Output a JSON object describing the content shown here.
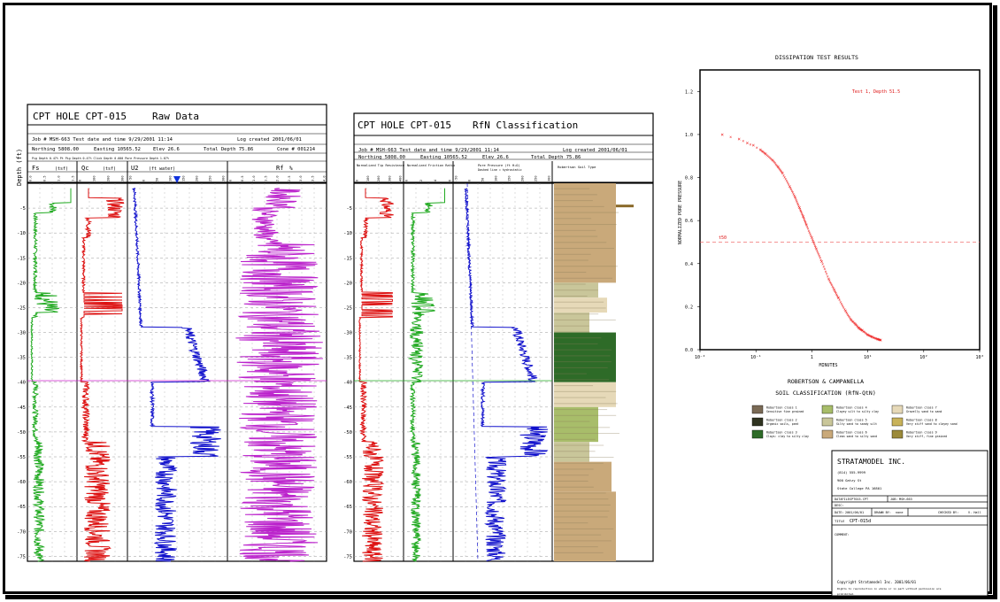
{
  "raw_panel": {
    "title": "CPT HOLE CPT-015",
    "subtitle": "Raw Data",
    "job_line": "Job # MSH-663  Test date and time 9/29/2001 11:14",
    "log_created": "Log created 2001/06/01",
    "northing": "Northing  5808.00",
    "easting": "Easting  10565.52",
    "elev": "Elev  26.6",
    "total_depth": "Total Depth  75.86",
    "cone": "Cone # 001214",
    "smallnote": "Pig Depth 0.47%  Pt Pig Depth 0.47%  Click Depth 0.000  Pore Pressure Depth 1.87%",
    "depth_axis_label": "Depth (ft)",
    "tracks": [
      {
        "label": "Fs",
        "unit": "(tsf)",
        "color": "#22aa22"
      },
      {
        "label": "Qc",
        "unit": "(tsf)",
        "color": "#dd1111"
      },
      {
        "label": "U2",
        "unit": "(ft water)",
        "color": "#1111cc"
      },
      {
        "label": "Rf",
        "unit": "%",
        "color": "#bb22cc"
      }
    ],
    "fs_ticks": [
      "0.0",
      "0.5",
      "1.0",
      "1.5"
    ],
    "qc_ticks": [
      "0",
      "100",
      "200",
      "300"
    ],
    "u2_ticks": [
      "-50",
      "0",
      "50",
      "100",
      "150",
      "200",
      "250",
      "300"
    ],
    "rf_ticks": [
      "0",
      "0.5",
      "1.0",
      "1.5",
      "2.0",
      "2.5",
      "3.0",
      "3.5",
      "4.0"
    ]
  },
  "class_panel": {
    "title": "CPT HOLE CPT-015",
    "subtitle": "RfN Classification",
    "job_line": "Job # MSH-663  Test date and time 9/29/2001 11:14",
    "log_created": "Log created 2001/06/01",
    "northing": "Northing  5808.00",
    "easting": "Easting  10565.52",
    "elev": "Elev  26.6",
    "total_depth": "Total Depth  75.86",
    "col1": "Normalized Tip Resistance",
    "col2": "Normalized Friction Ratio",
    "col3a": "Pore Pressure  (ft H₂O)",
    "col3b": "Dashed line = hydrostatic",
    "col4": "Robertson Soil Type"
  },
  "depth_ticks": [
    "-5",
    "-10",
    "-15",
    "-20",
    "-25",
    "-30",
    "-35",
    "-40",
    "-45",
    "-50",
    "-55",
    "-60",
    "-65",
    "-70",
    "-75"
  ],
  "chart_data": {
    "type": "scatter",
    "title": "DISSIPATION TEST RESULTS",
    "annotation": "Test 1, Depth 51.5",
    "xlabel": "MINUTES",
    "ylabel": "NORMALIZED PORE PRESSURE",
    "xscale": "log",
    "x_ticks": [
      "10⁻²",
      "10⁻¹",
      "1",
      "10¹",
      "10²",
      "10³"
    ],
    "y_ticks": [
      "0.0",
      "0.2",
      "0.4",
      "0.6",
      "0.8",
      "1.0",
      "1.2"
    ],
    "ylim": [
      0,
      1.3
    ],
    "xlim": [
      0.01,
      1000
    ],
    "t50_label": "t50",
    "t50_level": 0.5,
    "series": [
      {
        "x": [
          0.025,
          0.05,
          0.07,
          0.09,
          0.12,
          0.15,
          0.2,
          0.25,
          0.3,
          0.4,
          0.5,
          0.6,
          0.7,
          0.8,
          1.0,
          1.2,
          1.5,
          2.0,
          2.5,
          3.0,
          4.0,
          5.0,
          6.0,
          7.0,
          8.0,
          10.0,
          12.0,
          15.0,
          17.0
        ],
        "y": [
          1.0,
          0.98,
          0.96,
          0.95,
          0.93,
          0.91,
          0.88,
          0.85,
          0.82,
          0.76,
          0.71,
          0.66,
          0.62,
          0.58,
          0.52,
          0.47,
          0.41,
          0.33,
          0.28,
          0.24,
          0.18,
          0.14,
          0.12,
          0.1,
          0.09,
          0.07,
          0.06,
          0.05,
          0.045
        ]
      }
    ]
  },
  "legend": {
    "title1": "ROBERTSON & CAMPANELLA",
    "title2": "SOIL CLASSIFICATION (RfN-QtN)",
    "items": [
      {
        "name": "Robertson class 1",
        "desc": "Sensitive fine grained",
        "color": "#7a6a55"
      },
      {
        "name": "Robertson class 2",
        "desc": "Organic soils, peat",
        "color": "#2f3320"
      },
      {
        "name": "Robertson class 3",
        "desc": "Clays: clay to silty clay",
        "color": "#2e6b28"
      },
      {
        "name": "Robertson class 4",
        "desc": "Clayey silt to silty clay",
        "color": "#a8bd6a"
      },
      {
        "name": "Robertson class 5",
        "desc": "Silty sand to sandy silt",
        "color": "#c9c69a"
      },
      {
        "name": "Robertson class 6",
        "desc": "Clean sand to silty sand",
        "color": "#c9a97a"
      },
      {
        "name": "Robertson class 7",
        "desc": "Gravelly sand to sand",
        "color": "#e6d9b8"
      },
      {
        "name": "Robertson class 8",
        "desc": "Very stiff sand to clayey sand",
        "color": "#c8b25a"
      },
      {
        "name": "Robertson class 9",
        "desc": "Very stiff, fine grained",
        "color": "#9b8a3a"
      }
    ]
  },
  "title_block": {
    "company": "STRATAMODEL INC.",
    "phone": "(814) 555-9999",
    "street": "900 Gatzy St",
    "city": "State College  PA  16801",
    "datafile_label": "DATAFILE:",
    "datafile": "CPT015.CPT",
    "job_label": "JOB:",
    "job": "MSH-663",
    "desc_label": "DESC:",
    "date_label": "DATE:",
    "date": "2001/06/01",
    "drawn_label": "DRAWN BY:",
    "drawn": "none",
    "checked_label": "CHECKED BY:",
    "checked": "V. Hall",
    "title_label": "TITLE",
    "title": "CPT-015d",
    "comment_label": "COMMENT:",
    "copyright": "Copyright Stratamodel Inc. 2001/06/01",
    "rights1": "Rights to reproduction in whole or in part without permission are",
    "rights2": "prohibited."
  }
}
